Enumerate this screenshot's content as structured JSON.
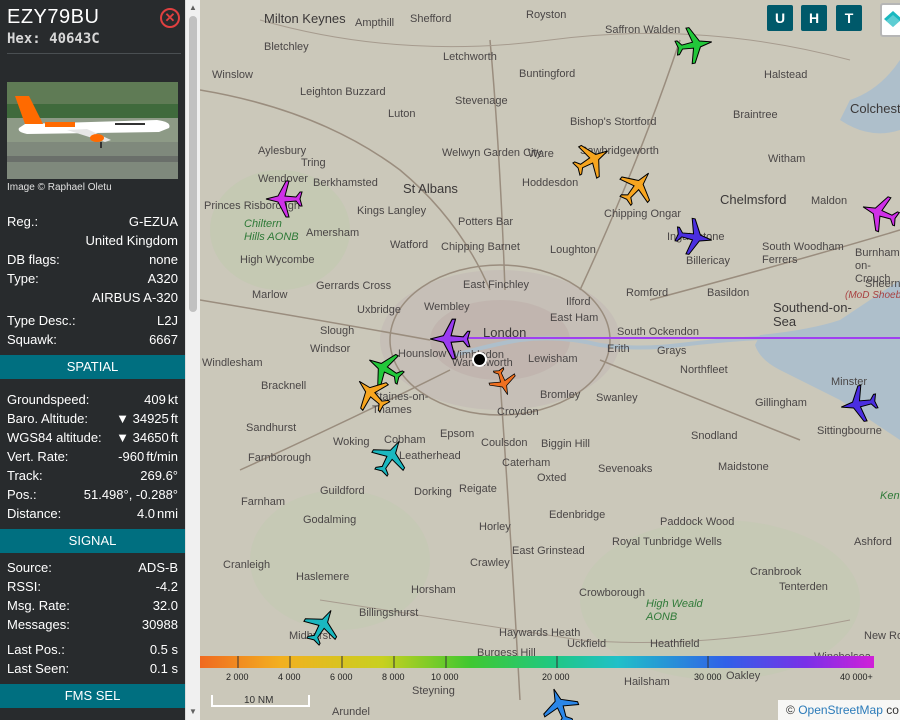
{
  "aircraft": {
    "callsign": "EZY79BU",
    "hex_label": "Hex: 40643C",
    "photo_credit": "Image © Raphael Oletu"
  },
  "details": {
    "reg_label": "Reg.:",
    "reg_value": "G-EZUA",
    "country": "United Kingdom",
    "dbflags_label": "DB flags:",
    "dbflags_value": "none",
    "type_label": "Type:",
    "type_value": "A320",
    "type_full": "AIRBUS A-320",
    "typedesc_label": "Type Desc.:",
    "typedesc_value": "L2J",
    "squawk_label": "Squawk:",
    "squawk_value": "6667"
  },
  "spatial": {
    "header": "SPATIAL",
    "groundspeed_label": "Groundspeed:",
    "groundspeed_value": "409",
    "groundspeed_unit": "kt",
    "baro_label": "Baro. Altitude:",
    "baro_value": "▼ 34925",
    "baro_unit": "ft",
    "wgs_label": "WGS84 altitude:",
    "wgs_value": "▼ 34650",
    "wgs_unit": "ft",
    "vrate_label": "Vert. Rate:",
    "vrate_value": "-960",
    "vrate_unit": "ft/min",
    "track_label": "Track:",
    "track_value": "269.6°",
    "pos_label": "Pos.:",
    "pos_value": "51.498°, -0.288°",
    "dist_label": "Distance:",
    "dist_value": "4.0",
    "dist_unit": "nmi"
  },
  "signal": {
    "header": "SIGNAL",
    "source_label": "Source:",
    "source_value": "ADS-B",
    "rssi_label": "RSSI:",
    "rssi_value": "-4.2",
    "msgrate_label": "Msg. Rate:",
    "msgrate_value": "32.0",
    "messages_label": "Messages:",
    "messages_value": "30988",
    "lastpos_label": "Last Pos.:",
    "lastpos_value": "0.5 s",
    "lastseen_label": "Last Seen:",
    "lastseen_value": "0.1 s"
  },
  "fms": {
    "header": "FMS SEL"
  },
  "map_buttons": {
    "u": "U",
    "h": "H",
    "t": "T"
  },
  "places": [
    "Milton Keynes",
    "Ampthill",
    "Shefford",
    "Royston",
    "Saffron Walden",
    "Bletchley",
    "Letchworth",
    "Winslow",
    "Leighton Buzzard",
    "Stevenage",
    "Buntingford",
    "Halstead",
    "Luton",
    "Bishop's Stortford",
    "Braintree",
    "Colchester",
    "Aylesbury",
    "Tring",
    "Welwyn Garden City",
    "Ware",
    "Sawbridgeworth",
    "Witham",
    "Wendover",
    "Berkhamsted",
    "St Albans",
    "Hoddesdon",
    "Princes Risborough",
    "Kings Langley",
    "Potters Bar",
    "Chipping Ongar",
    "Chelmsford",
    "Maldon",
    "Chiltern Hills AONB",
    "Amersham",
    "Watford",
    "Chipping Barnet",
    "Loughton",
    "Ingatestone",
    "South Woodham Ferrers",
    "High Wycombe",
    "Billericay",
    "Burnham-on-Crouch",
    "Gerrards Cross",
    "East Finchley",
    "Romford",
    "Basildon",
    "Marlow",
    "Wembley",
    "Ilford",
    "Southend-on-Sea",
    "Uxbridge",
    "East Ham",
    "Slough",
    "London",
    "South Ockendon",
    "Windsor",
    "Hounslow",
    "Wandsworth",
    "Lewisham",
    "Erith",
    "Grays",
    "Wimbledon",
    "Northfleet",
    "Bracknell",
    "Bromley",
    "Swanley",
    "Gillingham",
    "Minster",
    "Staines-on-Thames",
    "Croydon",
    "Sittingbourne",
    "Sandhurst",
    "Cobham",
    "Epsom",
    "Coulsdon",
    "Biggin Hill",
    "Snodland",
    "Woking",
    "Leatherhead",
    "Caterham",
    "Sevenoaks",
    "Maidstone",
    "Farnborough",
    "Oxted",
    "Guildford",
    "Dorking",
    "Reigate",
    "Farnham",
    "Edenbridge",
    "Godalming",
    "Horley",
    "Paddock Wood",
    "Royal Tunbridge Wells",
    "Ashford",
    "Cranleigh",
    "East Grinstead",
    "Crawley",
    "Cranbrook",
    "Haslemere",
    "Tenterden",
    "Horsham",
    "Crowborough",
    "High Weald AONB",
    "Billingshurst",
    "Haywards Heath",
    "Heathfield",
    "Midhurst",
    "Uckfield",
    "Burgess Hill",
    "Hailsham",
    "Steyning",
    "New Romney",
    "Arundel",
    "Winchelsea",
    "Oakley",
    "Kent",
    "Sheerness",
    "(MoD Shoeburyness)",
    "Windlesham"
  ],
  "altitude_legend": [
    "2 000",
    "4 000",
    "6 000",
    "8 000",
    "10 000",
    "20 000",
    "30 000",
    "40 000+"
  ],
  "scale_label": "10 NM",
  "attribution": {
    "symbol": "©",
    "link": "OpenStreetMap",
    "suffix": "co"
  },
  "colors": {
    "sidebar": "#282b2d",
    "section": "#006f80",
    "button": "#00596a",
    "track": "#a040f0",
    "selected": "#9a3cf0"
  }
}
